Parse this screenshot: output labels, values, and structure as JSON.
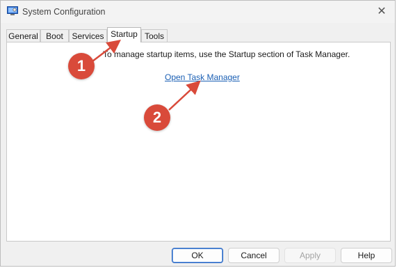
{
  "window": {
    "title": "System Configuration",
    "close_glyph": "✕"
  },
  "tabs": [
    {
      "label": "General",
      "active": false
    },
    {
      "label": "Boot",
      "active": false
    },
    {
      "label": "Services",
      "active": false
    },
    {
      "label": "Startup",
      "active": true
    },
    {
      "label": "Tools",
      "active": false
    }
  ],
  "startup": {
    "info_text": "To manage startup items, use the Startup section of Task Manager.",
    "link_text": "Open Task Manager"
  },
  "buttons": {
    "ok": "OK",
    "cancel": "Cancel",
    "apply": "Apply",
    "help": "Help"
  },
  "markers": {
    "first": "1",
    "second": "2"
  },
  "colors": {
    "marker": "#d94a3a",
    "link": "#1a5fb4",
    "ok_border": "#1f5fbf"
  }
}
